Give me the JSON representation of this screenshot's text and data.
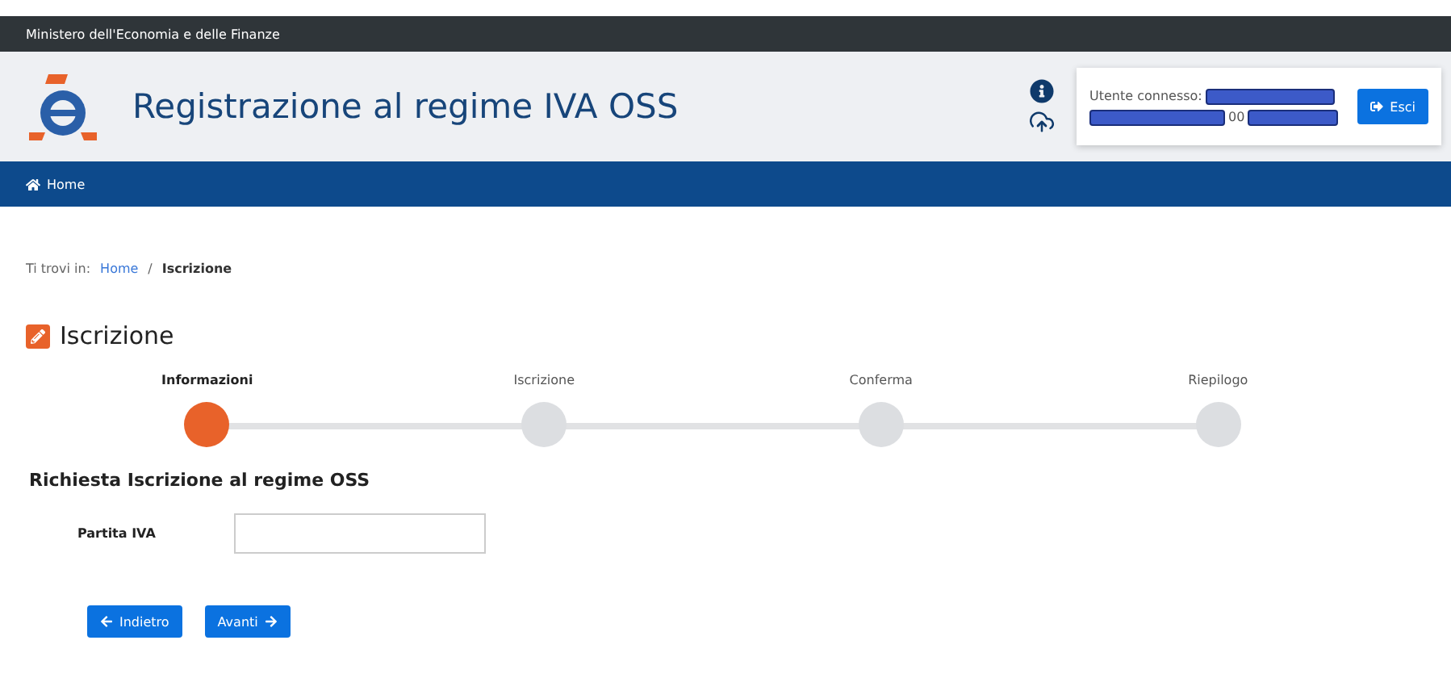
{
  "top_bar": {
    "ministry": "Ministero dell'Economia e delle Finanze"
  },
  "header": {
    "title": "Registrazione al regime IVA OSS",
    "user_box": {
      "label": "Utente connesso:",
      "fragment": "00",
      "logout": "Esci"
    }
  },
  "nav": {
    "items": [
      {
        "label": "Home"
      }
    ]
  },
  "breadcrumb": {
    "prefix": "Ti trovi in:",
    "separator": "/",
    "items": [
      {
        "label": "Home",
        "current": false
      },
      {
        "label": "Iscrizione",
        "current": true
      }
    ]
  },
  "page_title": "Iscrizione",
  "steps": [
    {
      "label": "Informazioni",
      "selected": true
    },
    {
      "label": "Iscrizione",
      "selected": false
    },
    {
      "label": "Conferma",
      "selected": false
    },
    {
      "label": "Riepilogo",
      "selected": false
    }
  ],
  "section_title": "Richiesta Iscrizione al regime OSS",
  "fields": [
    {
      "label": "Partita IVA"
    }
  ],
  "buttons": [
    {
      "label": "Indietro",
      "kind": "back"
    },
    {
      "label": "Avanti",
      "kind": "next"
    }
  ]
}
